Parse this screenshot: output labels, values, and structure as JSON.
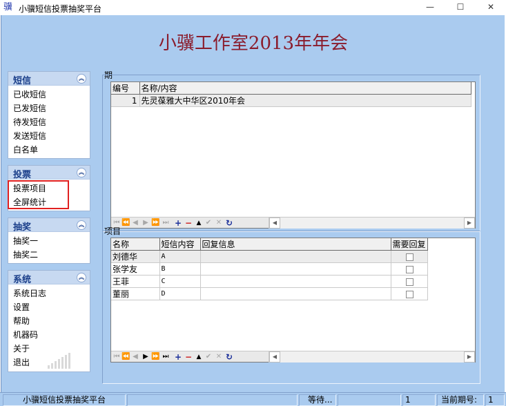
{
  "window": {
    "title": "小骥短信投票抽奖平台",
    "icon_glyph": "骥",
    "minimize_glyph": "—",
    "maximize_glyph": "☐",
    "close_glyph": "✕"
  },
  "banner": {
    "title": "小骥工作室2013年年会"
  },
  "sidebar": {
    "sms": {
      "title": "短信",
      "items": [
        "已收短信",
        "已发短信",
        "待发短信",
        "发送短信",
        "白名单"
      ]
    },
    "vote": {
      "title": "投票",
      "items": [
        "投票项目",
        "全屏统计"
      ]
    },
    "lottery": {
      "title": "抽奖",
      "items": [
        "抽奖一",
        "抽奖二"
      ]
    },
    "system": {
      "title": "系统",
      "items": [
        "系统日志",
        "设置",
        "帮助",
        "机器码",
        "关于",
        "退出"
      ]
    },
    "collapse_glyph": "︽"
  },
  "periods": {
    "label": "期",
    "columns": [
      "编号",
      "名称/内容"
    ],
    "rows": [
      {
        "id": "1",
        "name": "先灵葆雅大中华区2010年会"
      }
    ]
  },
  "items": {
    "label": "项目",
    "columns": [
      "名称",
      "短信内容",
      "回复信息",
      "需要回复"
    ],
    "rows": [
      {
        "name": "刘德华",
        "sms": "A",
        "reply": "",
        "need_reply": false
      },
      {
        "name": "张学友",
        "sms": "B",
        "reply": "",
        "need_reply": false
      },
      {
        "name": "王菲",
        "sms": "C",
        "reply": "",
        "need_reply": false
      },
      {
        "name": "董丽",
        "sms": "D",
        "reply": "",
        "need_reply": false
      }
    ]
  },
  "navigator": {
    "first": "⏮",
    "prior_page": "⏪",
    "prior": "◀",
    "next": "▶",
    "next_page": "⏩",
    "last": "⏭",
    "insert": "+",
    "delete": "−",
    "edit": "▲",
    "post": "✔",
    "cancel": "✕",
    "refresh": "↻",
    "scroll_left": "◀",
    "scroll_right": "▶"
  },
  "statusbar": {
    "app_name": "小骥短信投票抽奖平台",
    "state": "等待...",
    "count": "1",
    "period_label": "当前期号:",
    "period_value": "1"
  },
  "colors": {
    "background": "#aacbef",
    "banner_title": "#8a1c2c",
    "highlight": "#e02020"
  }
}
